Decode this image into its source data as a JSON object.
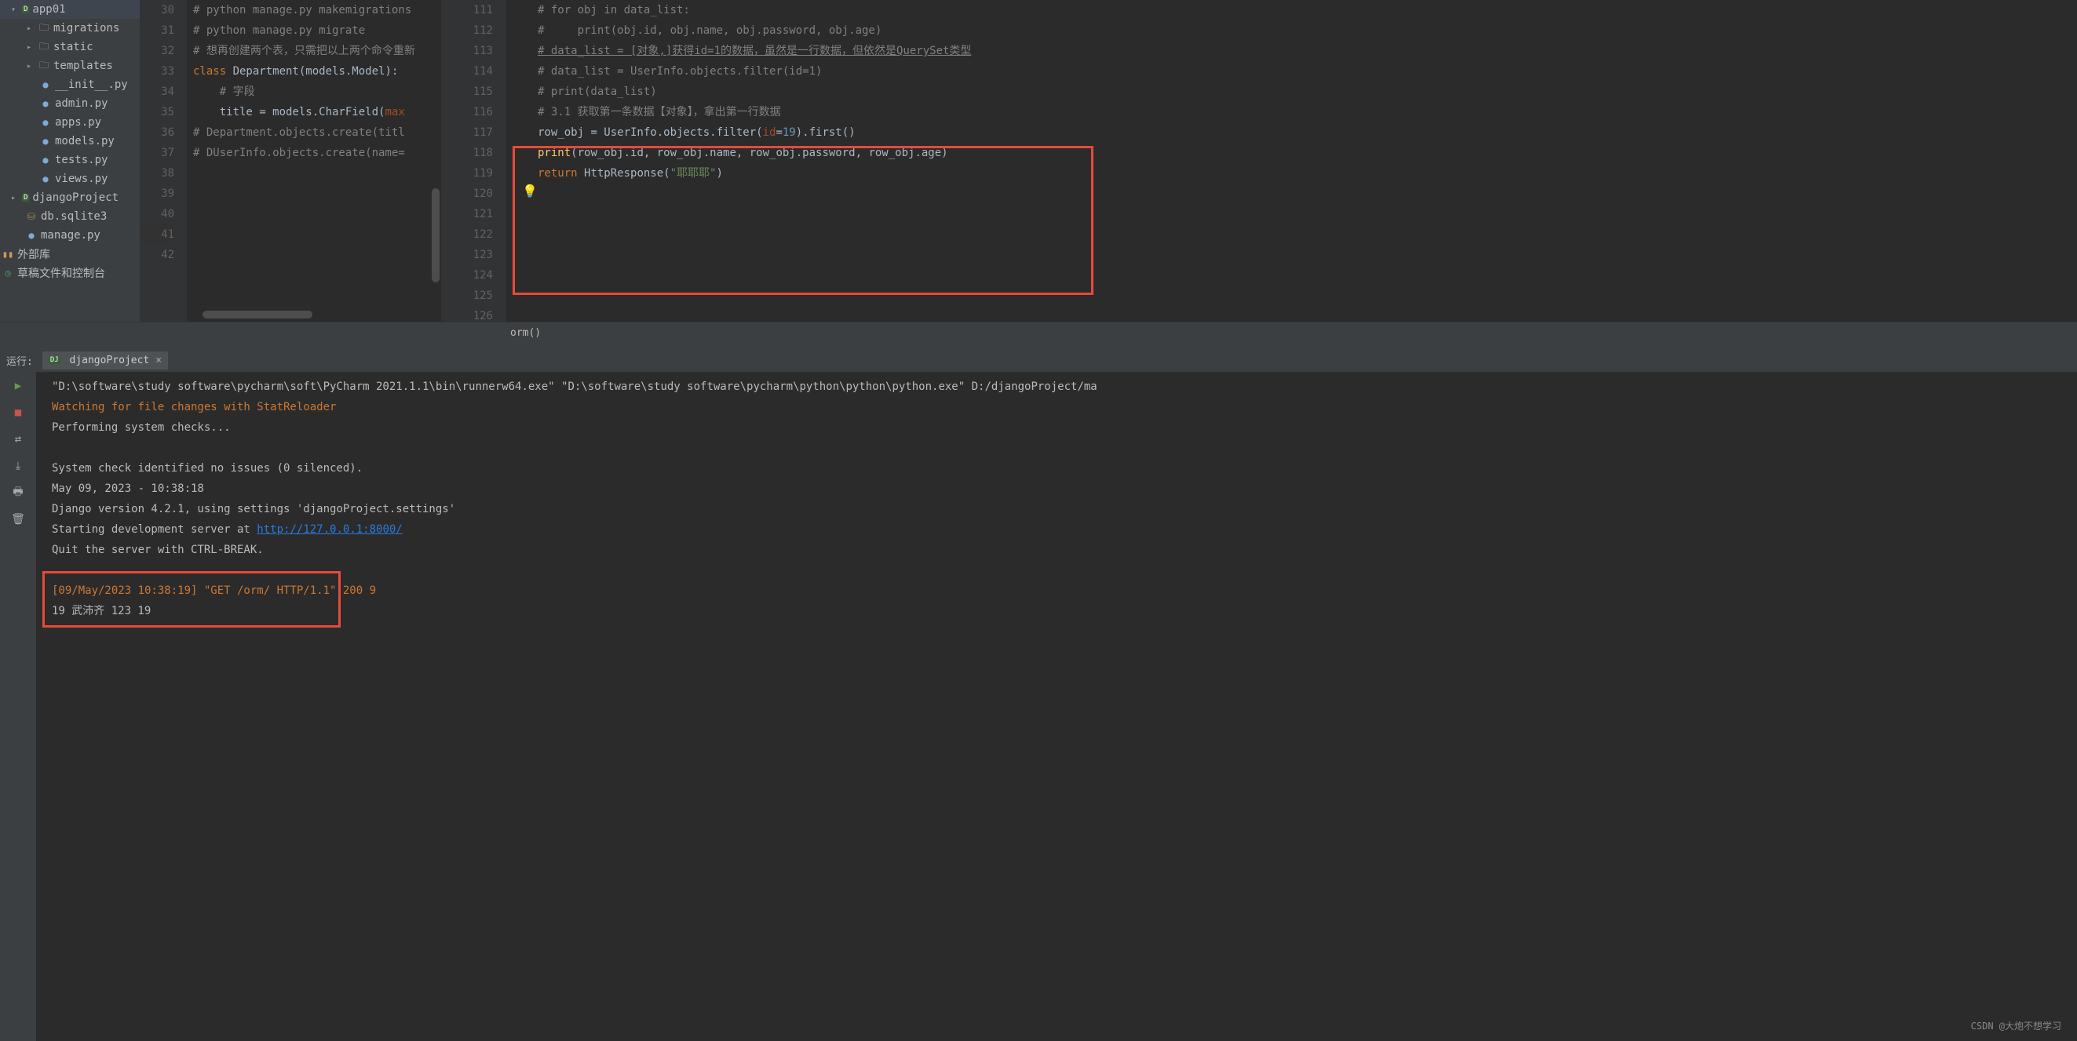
{
  "tree": {
    "app01": "app01",
    "migrations": "migrations",
    "static": "static",
    "templates": "templates",
    "init": "__init__.py",
    "admin": "admin.py",
    "apps": "apps.py",
    "models": "models.py",
    "tests": "tests.py",
    "views": "views.py",
    "djangoProject": "djangoProject",
    "db": "db.sqlite3",
    "manage": "manage.py",
    "extlib": "外部库",
    "scratch": "草稿文件和控制台"
  },
  "left_lines": [
    "30",
    "31",
    "32",
    "33",
    "34",
    "35",
    "36",
    "37",
    "38",
    "39",
    "40",
    "41",
    "42"
  ],
  "left_code": {
    "l30": "# python manage.py makemigrations",
    "l31": "# python manage.py migrate",
    "l32": "",
    "l33a": "#",
    "l33b": " 想再创建两个表，只需把以上两个命令重新",
    "l34a": "class ",
    "l34b": "Department(models.Model):",
    "l35": "# 字段",
    "l36a": "title = models.CharField(",
    "l36b": "max",
    "l37": "",
    "l38": "# Department.objects.create(titl",
    "l39": "# DUserInfo.objects.create(name=",
    "l40": "",
    "l41": "",
    "l42": ""
  },
  "mid_lines": [
    "111",
    "112",
    "113",
    "114",
    "115",
    "116",
    "117",
    "118",
    "119",
    "120",
    "121",
    "122",
    "123",
    "124",
    "125",
    "126"
  ],
  "right_code": {
    "r111": "# for obj in data_list:",
    "r112": "#     print(obj.id, obj.name, obj.password, obj.age)",
    "r113": "",
    "r114": "",
    "r115": "# data_list = [对象,]获得id=1的数据，虽然是一行数据，但依然是QuerySet类型",
    "r116": "# data_list = UserInfo.objects.filter(id=1)",
    "r117": "# print(data_list)",
    "r118": "",
    "r119": "# 3.1 获取第一条数据【对象】，拿出第一行数据",
    "r120a": "row_obj = UserInfo.objects.filter(",
    "r120b": "id",
    "r120c": "=",
    "r120d": "19",
    "r120e": ").first()",
    "r121a": "print",
    "r121b": "(row_obj.id, row_obj.name, row_obj.password, row_obj.age)",
    "r122": "",
    "r123a": "return ",
    "r123b": "HttpResponse(",
    "r123c": "\"耶耶耶\"",
    "r123d": ")",
    "r124": "",
    "r125": "",
    "r126": ""
  },
  "breadcrumb": "orm()",
  "run": {
    "label": "运行:",
    "tab": "djangoProject",
    "console": {
      "l1": "\"D:\\software\\study software\\pycharm\\soft\\PyCharm 2021.1.1\\bin\\runnerw64.exe\" \"D:\\software\\study software\\pycharm\\python\\python\\python.exe\" D:/djangoProject/ma",
      "l2": "Watching for file changes with StatReloader",
      "l3": "Performing system checks...",
      "l4": "",
      "l5": "System check identified no issues (0 silenced).",
      "l6": "May 09, 2023 - 10:38:18",
      "l7": "Django version 4.2.1, using settings 'djangoProject.settings'",
      "l8a": "Starting development server at ",
      "l8b": "http://127.0.0.1:8000/",
      "l9": "Quit the server with CTRL-BREAK.",
      "l10": "",
      "l11": "[09/May/2023 10:38:19] \"GET /orm/ HTTP/1.1\" 200 9",
      "l12": "19 武沛齐 123 19"
    }
  },
  "credit": "CSDN @大炮不想学习"
}
